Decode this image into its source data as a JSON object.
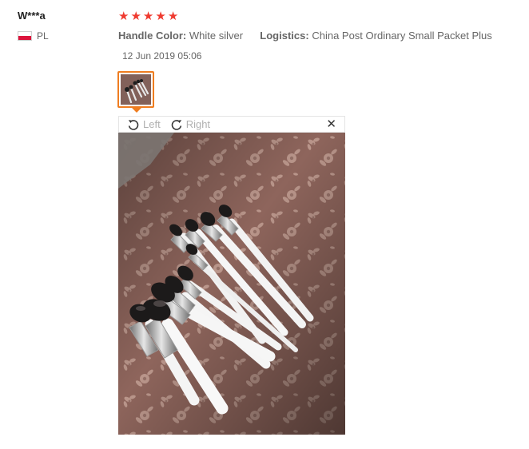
{
  "review": {
    "user_name": "W***a",
    "country_code": "PL",
    "rating_stars": 5,
    "attributes": [
      {
        "label": "Handle Color:",
        "value": "White silver"
      },
      {
        "label": "Logistics:",
        "value": "China Post Ordinary Small Packet Plus"
      }
    ],
    "date": "12 Jun 2019 05:06"
  },
  "viewer": {
    "rotate_left_label": "Left",
    "rotate_right_label": "Right",
    "close_glyph": "✕",
    "icons": [
      "rotate-left-icon",
      "rotate-right-icon",
      "close-icon"
    ]
  },
  "colors": {
    "star": "#ef3a2f",
    "thumb_border": "#ef7d20",
    "muted_text": "#666666"
  }
}
